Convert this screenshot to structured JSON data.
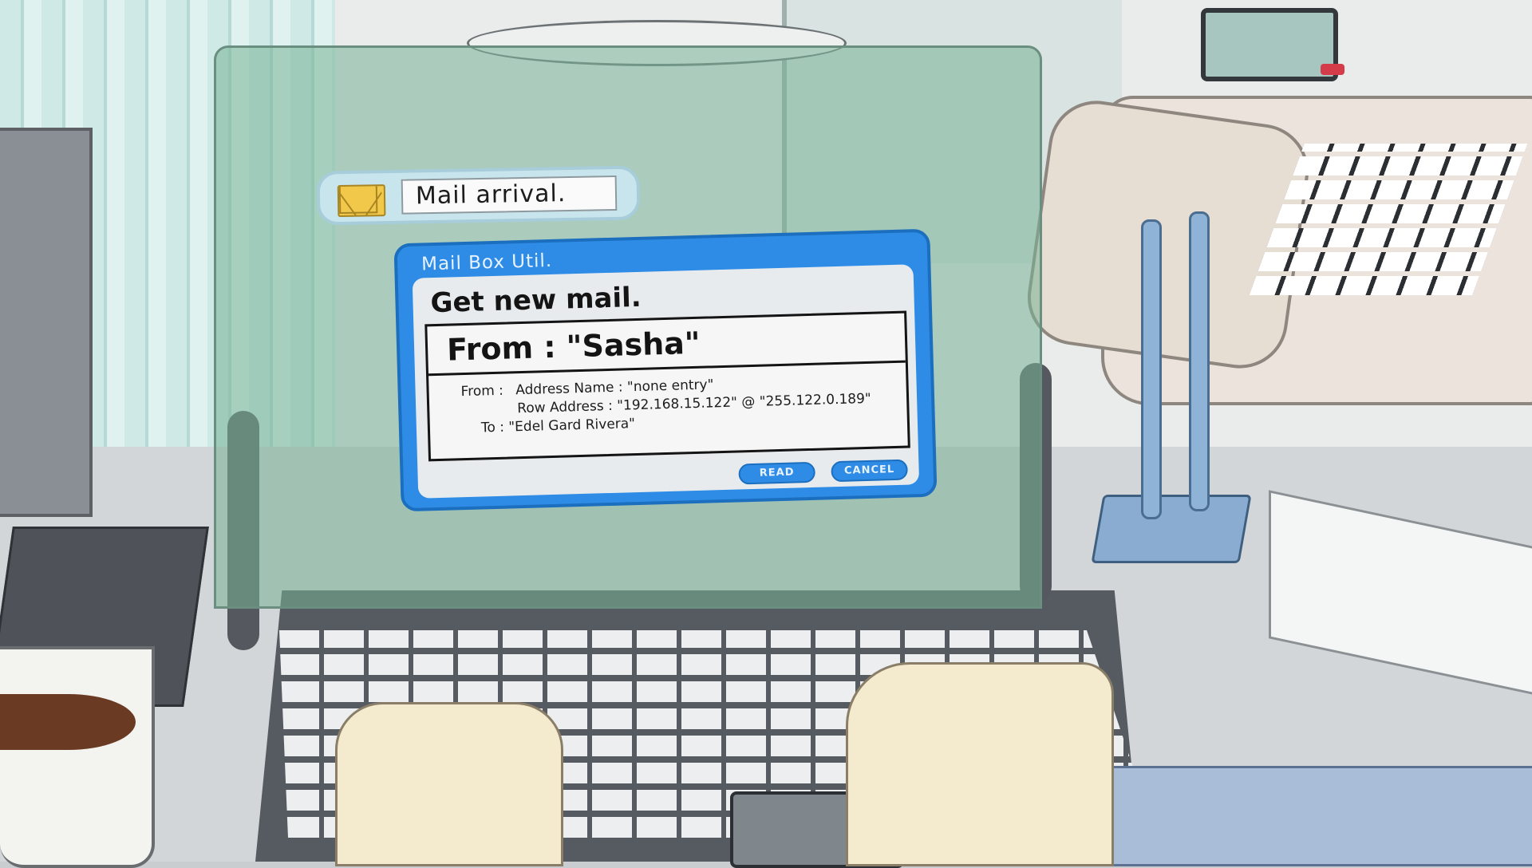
{
  "notification": {
    "icon": "envelope-icon",
    "text": "Mail arrival."
  },
  "dialog": {
    "title": "Mail Box Util.",
    "heading": "Get new mail.",
    "from_title": "From : \"Sasha\"",
    "details": {
      "from_label": "From :",
      "address_name": "Address Name : \"none entry\"",
      "row_address": "Row Address   : \"192.168.15.122\" @ \"255.122.0.189\"",
      "to": "To : \"Edel Gard Rivera\""
    },
    "buttons": {
      "read": "READ",
      "cancel": "CANCEL"
    },
    "colors": {
      "frame": "#2e8ce6",
      "panel": "#e8ebee"
    }
  }
}
